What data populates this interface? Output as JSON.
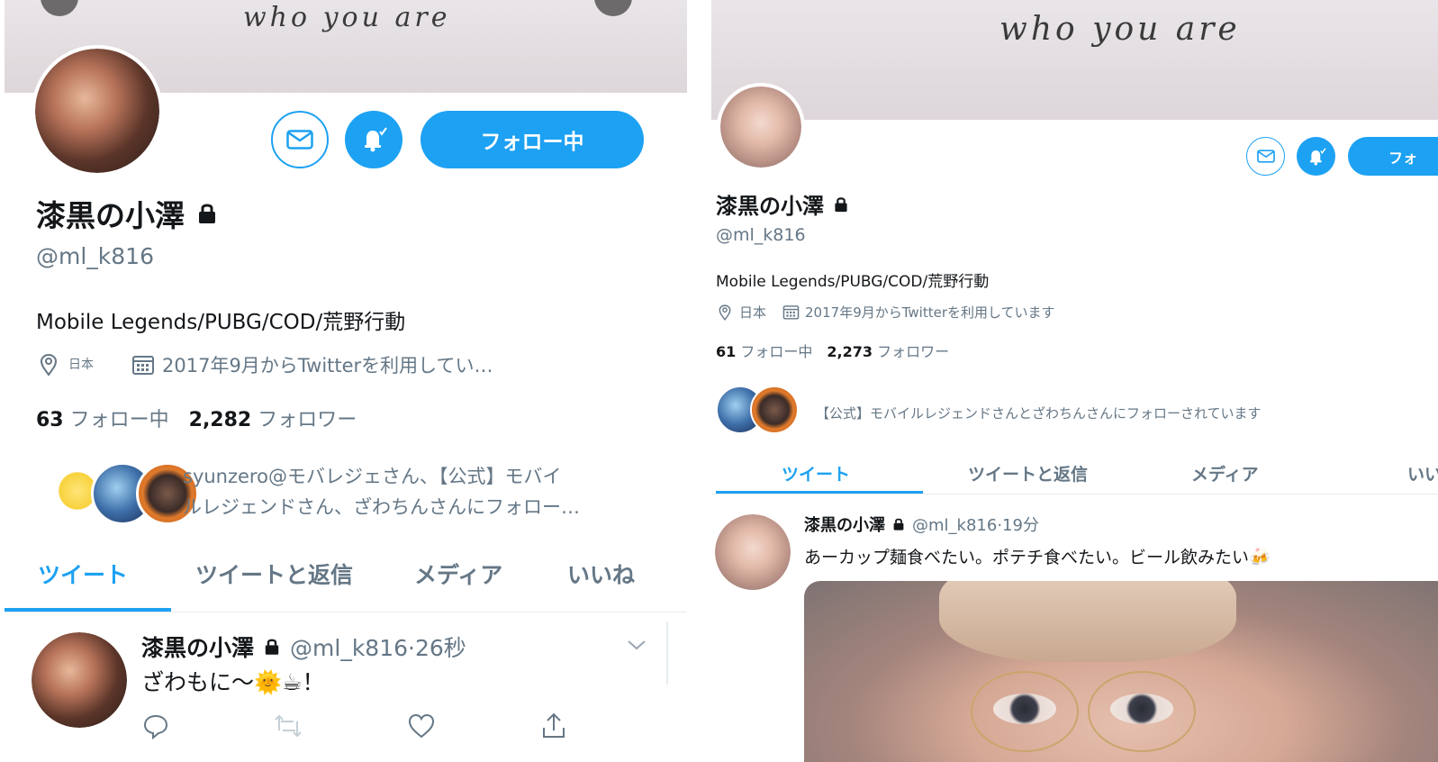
{
  "left": {
    "banner_text": "who you are",
    "follow_label": "フォロー中",
    "display_name": "漆黒の小澤",
    "handle": "@ml_k816",
    "bio": "Mobile Legends/PUBG/COD/荒野行動",
    "location": "日本",
    "joined": "2017年9月からTwitterを利用してい…",
    "following_count": "63",
    "following_label": "フォロー中",
    "followers_count": "2,282",
    "followers_label": "フォロワー",
    "followed_by_line1": "syunzero@モバレジェさん、【公式】モバイ",
    "followed_by_line2": "ルレジェンドさん、ざわちんさんにフォロー…",
    "tabs": [
      "ツイート",
      "ツイートと返信",
      "メディア",
      "いいね"
    ],
    "tweet": {
      "name": "漆黒の小澤",
      "handle_time": "@ml_k816·26秒",
      "text": "ざわもに〜🌞☕！"
    }
  },
  "right": {
    "banner_text": "who you are",
    "follow_label": "フォ",
    "display_name": "漆黒の小澤",
    "handle": "@ml_k816",
    "bio": "Mobile Legends/PUBG/COD/荒野行動",
    "location": "日本",
    "joined": "2017年9月からTwitterを利用しています",
    "following_count": "61",
    "following_label": "フォロー中",
    "followers_count": "2,273",
    "followers_label": "フォロワー",
    "followed_by": "【公式】モバイルレジェンドさんとざわちんさんにフォローされています",
    "tabs": [
      "ツイート",
      "ツイートと返信",
      "メディア",
      "いい"
    ],
    "tweet": {
      "name": "漆黒の小澤",
      "handle_time": "@ml_k816·19分",
      "text": "あーカップ麺食べたい。ポテチ食べたい。ビール飲みたい🍻"
    }
  },
  "colors": {
    "accent": "#1da1f2",
    "muted_text": "#657786",
    "primary_text": "#14171a"
  },
  "icons": [
    "mail-icon",
    "bell-icon",
    "lock-icon",
    "location-pin-icon",
    "calendar-icon",
    "reply-icon",
    "retweet-icon",
    "like-icon",
    "share-icon",
    "chevron-down-icon"
  ]
}
